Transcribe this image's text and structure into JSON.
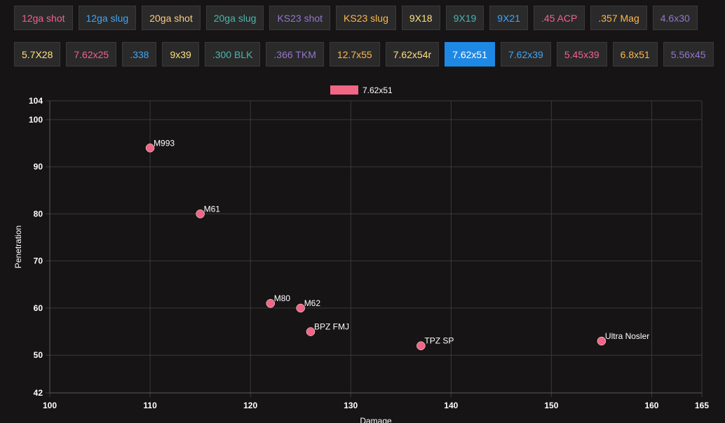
{
  "tabs": {
    "row1": [
      {
        "label": "12ga shot",
        "color": "#f06292"
      },
      {
        "label": "12ga slug",
        "color": "#42a5f5"
      },
      {
        "label": "20ga shot",
        "color": "#ffcc80"
      },
      {
        "label": "20ga slug",
        "color": "#4db6ac"
      },
      {
        "label": "KS23 shot",
        "color": "#9575cd"
      },
      {
        "label": "KS23 slug",
        "color": "#ffb74d"
      },
      {
        "label": "9X18",
        "color": "#ffe082"
      },
      {
        "label": "9X19",
        "color": "#4db6ac"
      },
      {
        "label": "9X21",
        "color": "#42a5f5"
      },
      {
        "label": ".45 ACP",
        "color": "#f06292"
      },
      {
        "label": ".357 Mag",
        "color": "#ffb74d"
      },
      {
        "label": "4.6x30",
        "color": "#9575cd"
      }
    ],
    "row2": [
      {
        "label": "5.7X28",
        "color": "#ffe082"
      },
      {
        "label": "7.62x25",
        "color": "#f06292"
      },
      {
        "label": ".338",
        "color": "#42a5f5"
      },
      {
        "label": "9x39",
        "color": "#ffe082"
      },
      {
        "label": ".300 BLK",
        "color": "#4db6ac"
      },
      {
        "label": ".366 TKM",
        "color": "#9575cd"
      },
      {
        "label": "12.7x55",
        "color": "#ffb74d"
      },
      {
        "label": "7.62x54r",
        "color": "#ffe082"
      },
      {
        "label": "7.62x51",
        "color": "#ffffff"
      },
      {
        "label": "7.62x39",
        "color": "#42a5f5"
      },
      {
        "label": "5.45x39",
        "color": "#f06292"
      },
      {
        "label": "6.8x51",
        "color": "#ffb74d"
      },
      {
        "label": "5.56x45",
        "color": "#9575cd"
      }
    ],
    "active": "7.62x51"
  },
  "chart_data": {
    "type": "scatter",
    "xlabel": "Damage",
    "ylabel": "Penetration",
    "xlim": [
      100,
      165
    ],
    "ylim": [
      42,
      104
    ],
    "xticks": [
      100,
      110,
      120,
      130,
      140,
      150,
      160,
      165
    ],
    "yticks": [
      42,
      50,
      60,
      70,
      80,
      90,
      100,
      104
    ],
    "grid": true,
    "legend_position": "top-center",
    "series": [
      {
        "name": "7.62x51",
        "color": "#f06684",
        "points": [
          {
            "label": "M993",
            "x": 110,
            "y": 94
          },
          {
            "label": "M61",
            "x": 115,
            "y": 80
          },
          {
            "label": "M80",
            "x": 122,
            "y": 61
          },
          {
            "label": "M62",
            "x": 125,
            "y": 60
          },
          {
            "label": "BPZ FMJ",
            "x": 126,
            "y": 55
          },
          {
            "label": "TPZ SP",
            "x": 137,
            "y": 52
          },
          {
            "label": "Ultra Nosler",
            "x": 155,
            "y": 53
          }
        ]
      }
    ]
  }
}
